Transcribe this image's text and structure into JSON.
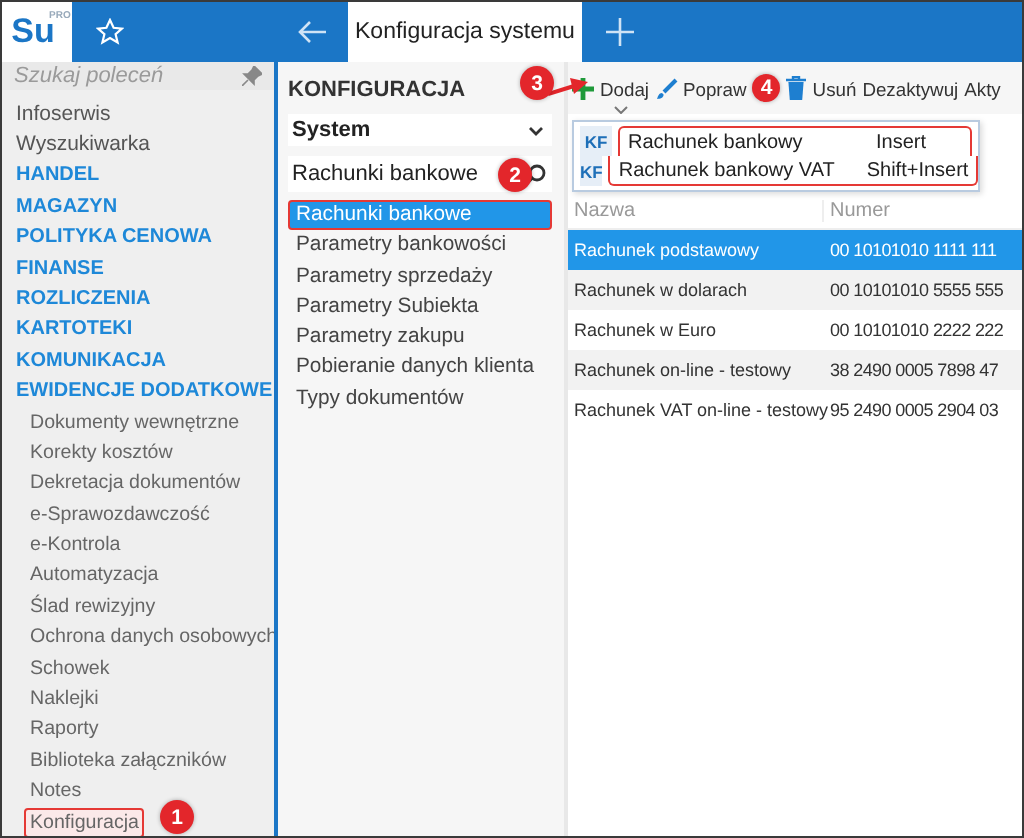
{
  "topbar": {
    "logo": "Su",
    "logo_tag": "PRO",
    "tab": {
      "title": "Konfiguracja systemu",
      "selected": true
    }
  },
  "sidebar": {
    "search": {
      "placeholder": "Szukaj poleceń"
    },
    "items": [
      {
        "label": "Infoserwis",
        "kind": "link"
      },
      {
        "label": "Wyszukiwarka",
        "kind": "link"
      },
      {
        "label": "HANDEL",
        "kind": "section"
      },
      {
        "label": "MAGAZYN",
        "kind": "section"
      },
      {
        "label": "POLITYKA CENOWA",
        "kind": "section"
      },
      {
        "label": "FINANSE",
        "kind": "section"
      },
      {
        "label": "ROZLICZENIA",
        "kind": "section"
      },
      {
        "label": "KARTOTEKI",
        "kind": "section"
      },
      {
        "label": "KOMUNIKACJA",
        "kind": "section"
      },
      {
        "label": "EWIDENCJE DODATKOWE",
        "kind": "section",
        "children": [
          {
            "label": "Dokumenty wewnętrzne",
            "highlighted": false
          },
          {
            "label": "Korekty kosztów",
            "highlighted": false
          },
          {
            "label": "Dekretacja dokumentów",
            "highlighted": false
          },
          {
            "label": "e-Sprawozdawczość",
            "highlighted": false
          },
          {
            "label": "e-Kontrola",
            "highlighted": false
          },
          {
            "label": "Automatyzacja",
            "highlighted": false
          },
          {
            "label": "Ślad rewizyjny",
            "highlighted": false
          },
          {
            "label": "Ochrona danych osobowych",
            "highlighted": false
          },
          {
            "label": "Schowek",
            "highlighted": false
          },
          {
            "label": "Naklejki",
            "highlighted": false
          },
          {
            "label": "Raporty",
            "highlighted": false
          },
          {
            "label": "Biblioteka załączników",
            "highlighted": false
          },
          {
            "label": "Notes",
            "highlighted": false
          },
          {
            "label": "Konfiguracja",
            "highlighted": true
          }
        ]
      }
    ]
  },
  "config": {
    "title": "KONFIGURACJA",
    "scope": "System",
    "search": {
      "value": "Rachunki bankowe"
    },
    "items": [
      {
        "label": "Rachunki bankowe",
        "selected": true,
        "highlighted": true
      },
      {
        "label": "Parametry bankowości",
        "selected": false,
        "highlighted": false
      },
      {
        "label": "Parametry sprzedaży",
        "selected": false,
        "highlighted": false
      },
      {
        "label": "Parametry Subiekta",
        "selected": false,
        "highlighted": false
      },
      {
        "label": "Parametry zakupu",
        "selected": false,
        "highlighted": false
      },
      {
        "label": "Pobieranie danych klienta",
        "selected": false,
        "highlighted": false
      },
      {
        "label": "Typy dokumentów",
        "selected": false,
        "highlighted": false
      }
    ]
  },
  "toolbar": [
    {
      "label": "Dodaj",
      "kind": "add"
    },
    {
      "label": "Popraw",
      "kind": "edit"
    },
    {
      "label": "Usuń",
      "kind": "delete"
    },
    {
      "label": "Dezaktywuj",
      "kind": "text"
    },
    {
      "label": "Akty",
      "kind": "text"
    }
  ],
  "add_menu": {
    "highlighted": true,
    "items": [
      {
        "badge": "KF",
        "label": "Rachunek bankowy",
        "shortcut": "Insert"
      },
      {
        "badge": "KF",
        "label": "Rachunek bankowy VAT",
        "shortcut": "Shift+Insert"
      }
    ]
  },
  "table": {
    "columns": [
      "Nazwa",
      "Numer"
    ],
    "rows": [
      {
        "cells": [
          "Rachunek podstawowy",
          "00 10101010 1111 111"
        ],
        "selected": true
      },
      {
        "cells": [
          "Rachunek w dolarach",
          "00 10101010 5555 555"
        ],
        "selected": false
      },
      {
        "cells": [
          "Rachunek w Euro",
          "00 10101010 2222 222"
        ],
        "selected": false
      },
      {
        "cells": [
          "Rachunek on-line - testowy",
          "38 2490 0005 7898 47"
        ],
        "selected": false
      },
      {
        "cells": [
          "Rachunek VAT on-line - testowy",
          "95 2490 0005 2904 03"
        ],
        "selected": false
      }
    ]
  },
  "callouts": [
    "1",
    "2",
    "3",
    "4"
  ]
}
